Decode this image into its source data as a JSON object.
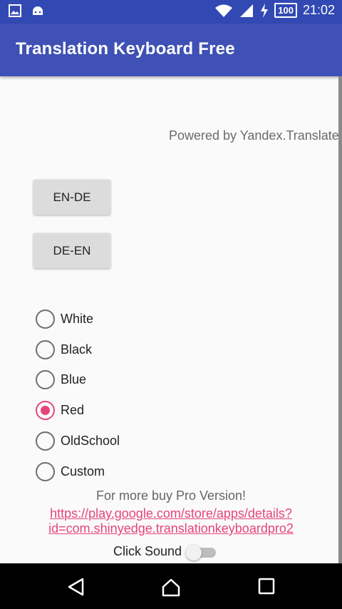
{
  "status_bar": {
    "icons": [
      "image-icon",
      "android-icon",
      "wifi-icon",
      "signal-icon",
      "charging-icon"
    ],
    "battery": "100",
    "time": "21:02"
  },
  "app_bar": {
    "title": "Translation Keyboard Free"
  },
  "powered_by": "Powered by Yandex.Translate",
  "buttons": {
    "en_de": "EN-DE",
    "de_en": "DE-EN"
  },
  "themes": [
    {
      "label": "White",
      "checked": false
    },
    {
      "label": "Black",
      "checked": false
    },
    {
      "label": "Blue",
      "checked": false
    },
    {
      "label": "Red",
      "checked": true
    },
    {
      "label": "OldSchool",
      "checked": false
    },
    {
      "label": "Custom",
      "checked": false
    }
  ],
  "promo": {
    "text": "For more buy Pro Version!",
    "link_line1": "https://play.google.com/store/apps/details?",
    "link_line2": "id=com.shinyedge.translationkeyboardpro2"
  },
  "click_sound": {
    "label": "Click Sound",
    "enabled": false
  },
  "colors": {
    "primary": "#3f51b5",
    "status": "#3249b4",
    "accent": "#e6457a"
  }
}
